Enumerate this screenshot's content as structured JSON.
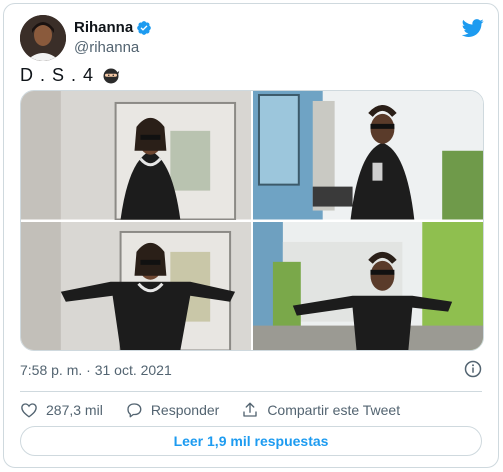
{
  "author": {
    "name": "Rihanna",
    "handle": "@rihanna"
  },
  "tweet": {
    "text": "D . S . 4",
    "emoji_icon": "ninja-icon",
    "timestamp": "7:58 p. m. · 31 oct. 2021"
  },
  "media": [
    {
      "name": "photo-1"
    },
    {
      "name": "photo-2"
    },
    {
      "name": "photo-3"
    },
    {
      "name": "photo-4"
    }
  ],
  "actions": {
    "like_count": "287,3 mil",
    "reply_label": "Responder",
    "share_label": "Compartir este Tweet"
  },
  "read_replies": "Leer 1,9 mil respuestas",
  "colors": {
    "accent": "#1d9bf0",
    "muted": "#536471",
    "border": "#cfd9de"
  }
}
